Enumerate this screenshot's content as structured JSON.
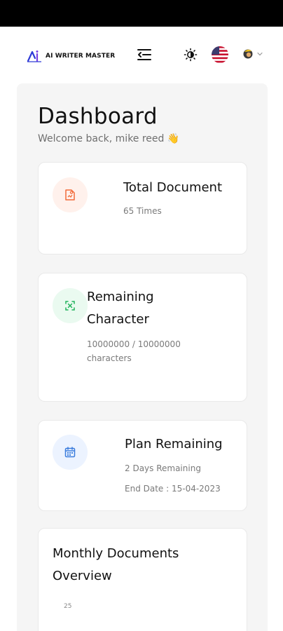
{
  "header": {
    "logo_text": "AI WRITER MASTER",
    "icons": [
      "menu-icon",
      "sun-icon",
      "us-flag-icon",
      "avatar-icon",
      "chevron-down-icon"
    ]
  },
  "page": {
    "title": "Dashboard",
    "welcome": "Welcome back, mike reed",
    "welcome_emoji": "👋"
  },
  "cards": [
    {
      "title": "Total Document",
      "lines": [
        "65 Times"
      ],
      "icon": "document-icon",
      "icon_color": "#f26b3a",
      "icon_bg": "#fff1ec"
    },
    {
      "title": "Remaining Character",
      "lines": [
        "10000000 / 10000000 characters"
      ],
      "icon": "scan-icon",
      "icon_color": "#22b35c",
      "icon_bg": "#eafaf0"
    },
    {
      "title": "Plan Remaining",
      "lines": [
        "2 Days Remaining",
        "End Date : 15-04-2023"
      ],
      "icon": "calendar-icon",
      "icon_color": "#3b7ddd",
      "icon_bg": "#ecf3ff"
    }
  ],
  "chart": {
    "title": "Monthly Documents Overview",
    "y_tick_top": "25"
  },
  "colors": {
    "logo_blue": "#2f3bd6",
    "logo_purple": "#7b3fe4",
    "content_bg": "#f5f5f5"
  }
}
